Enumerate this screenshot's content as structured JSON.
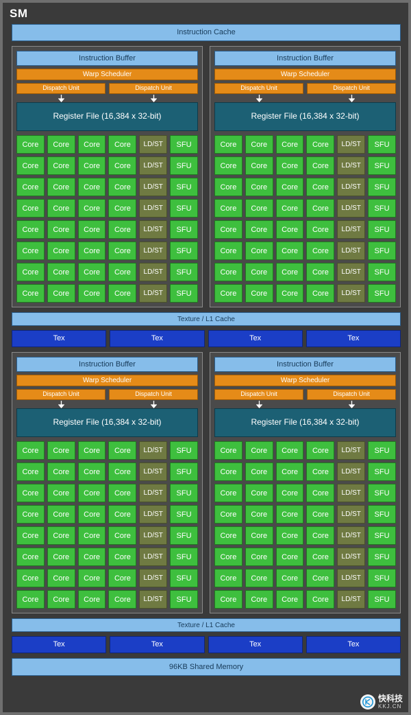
{
  "sm": {
    "title": "SM",
    "instruction_cache": "Instruction Cache",
    "shared_memory": "96KB Shared Memory"
  },
  "labels": {
    "instruction_buffer": "Instruction Buffer",
    "warp_scheduler": "Warp Scheduler",
    "dispatch_unit": "Dispatch Unit",
    "register_file": "Register File (16,384 x 32-bit)",
    "core": "Core",
    "ldst": "LD/ST",
    "sfu": "SFU",
    "texture_l1_cache": "Texture / L1 Cache",
    "tex": "Tex"
  },
  "colors": {
    "background": "#3a3a3a",
    "cache_blue": "#86bdea",
    "scheduler_orange": "#e58b18",
    "register_teal": "#1c6074",
    "core_green": "#3ebf3e",
    "ldst_olive": "#6f7a42",
    "tex_blue": "#1b3ec6",
    "partition_gray": "#4a4a4a"
  },
  "structure": {
    "processing_blocks": 4,
    "core_rows_per_block": 8,
    "cores_per_row": 4,
    "ldst_per_row": 1,
    "sfu_per_row": 1,
    "tex_units_per_half": 4
  },
  "watermark": {
    "cn": "快科技",
    "en": "KKJ.CN"
  }
}
